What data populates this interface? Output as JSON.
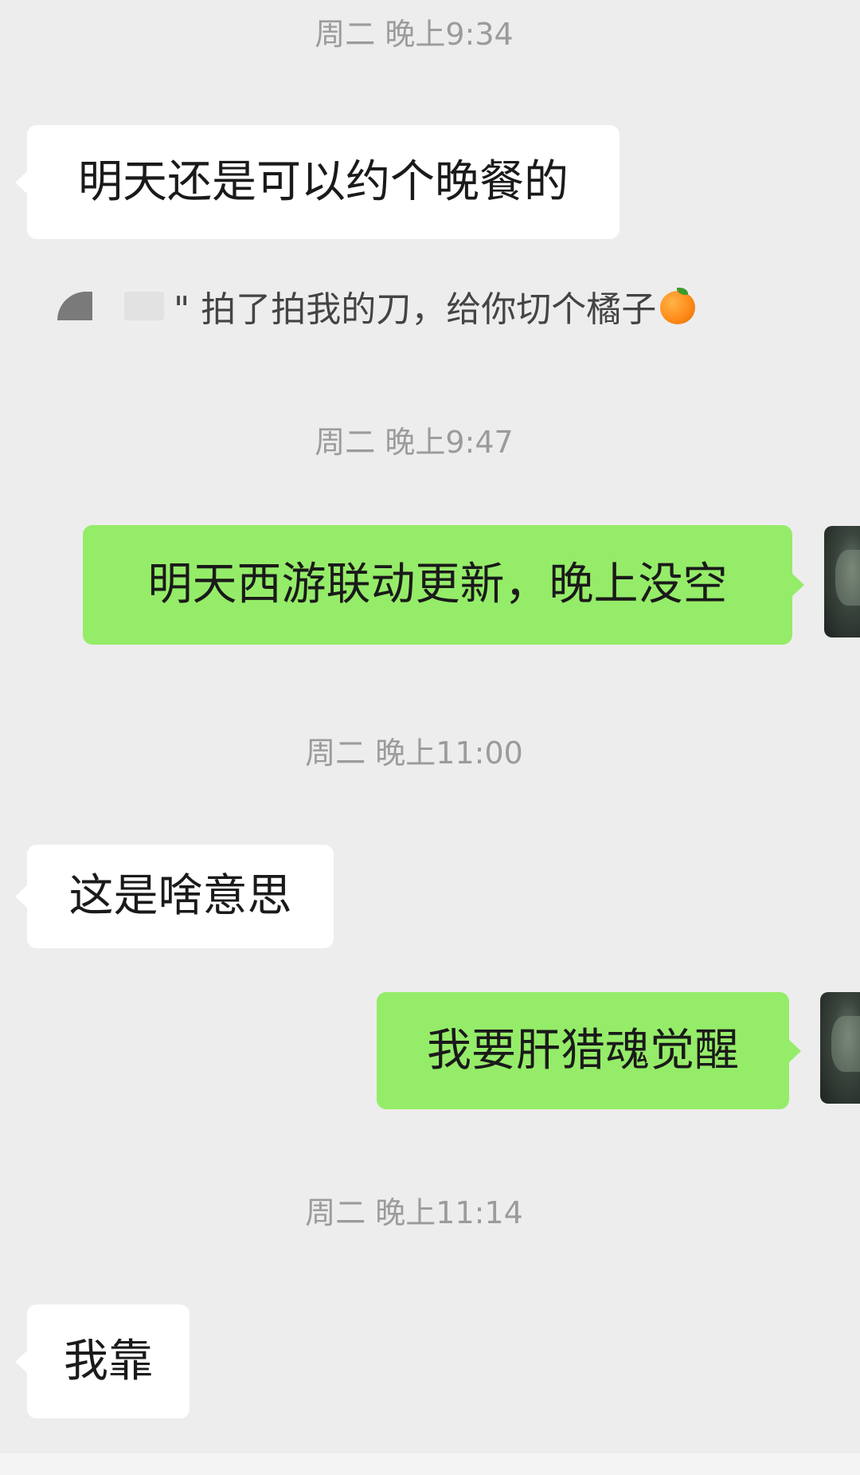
{
  "chat": {
    "timestamps": [
      "周二 晚上9:34",
      "周二 晚上9:47",
      "周二 晚上11:00",
      "周二 晚上11:14"
    ],
    "messages": [
      {
        "sender": "other",
        "text": "明天还是可以约个晚餐的"
      },
      {
        "sender": "me",
        "text": "明天西游联动更新，晚上没空"
      },
      {
        "sender": "other",
        "text": "这是啥意思"
      },
      {
        "sender": "me",
        "text": "我要肝猎魂觉醒"
      },
      {
        "sender": "other",
        "text": "我靠"
      }
    ],
    "system_notice": {
      "text": "\" 拍了拍我的刀，给你切个橘子",
      "emoji_icon": "orange-icon"
    }
  },
  "colors": {
    "background": "#ededed",
    "incoming_bubble": "#ffffff",
    "outgoing_bubble": "#95ec69",
    "timestamp_text": "#9b9b9b"
  }
}
